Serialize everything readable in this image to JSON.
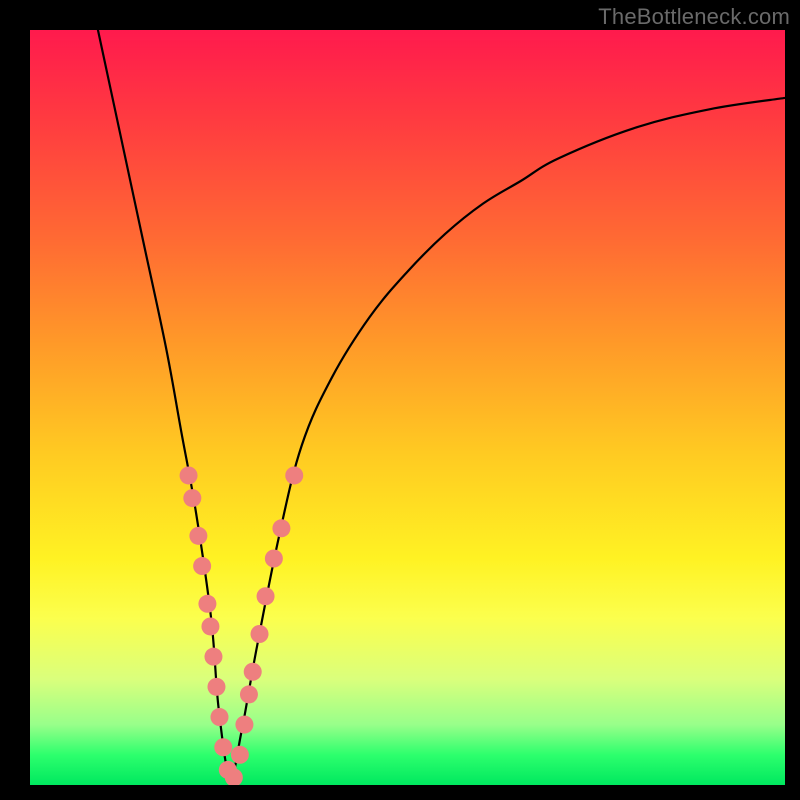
{
  "watermark": "TheBottleneck.com",
  "colors": {
    "frame": "#000000",
    "watermark_text": "#6a6a6a",
    "curve": "#000000",
    "dots": "#ee7f7f",
    "gradient_stops": [
      "#ff1a4d",
      "#ff3b40",
      "#ff6b33",
      "#ff9b28",
      "#ffca22",
      "#fff223",
      "#fbff4e",
      "#daff7c",
      "#98ff8a",
      "#2dff6d",
      "#00e85f"
    ]
  },
  "chart_data": {
    "type": "line",
    "title": "",
    "xlabel": "",
    "ylabel": "",
    "xlim": [
      0,
      100
    ],
    "ylim": [
      0,
      100
    ],
    "notes": "V-shaped bottleneck curve on vertical rainbow gradient; minimum is the optimal balance point; dots mark sampled hardware combos near the minimum.",
    "series": [
      {
        "name": "bottleneck-curve",
        "x": [
          9,
          12,
          15,
          18,
          20,
          22,
          24,
          25,
          26.5,
          28,
          30,
          33,
          36,
          40,
          45,
          50,
          55,
          60,
          65,
          70,
          80,
          90,
          100
        ],
        "y": [
          100,
          86,
          72,
          58,
          47,
          36,
          22,
          10,
          1,
          7,
          18,
          33,
          45,
          54,
          62,
          68,
          73,
          77,
          80,
          83,
          87,
          89.5,
          91
        ]
      }
    ],
    "points": [
      {
        "name": "sample",
        "x": 21.0,
        "y": 41
      },
      {
        "name": "sample",
        "x": 21.5,
        "y": 38
      },
      {
        "name": "sample",
        "x": 22.3,
        "y": 33
      },
      {
        "name": "sample",
        "x": 22.8,
        "y": 29
      },
      {
        "name": "sample",
        "x": 23.5,
        "y": 24
      },
      {
        "name": "sample",
        "x": 23.9,
        "y": 21
      },
      {
        "name": "sample",
        "x": 24.3,
        "y": 17
      },
      {
        "name": "sample",
        "x": 24.7,
        "y": 13
      },
      {
        "name": "sample",
        "x": 25.1,
        "y": 9
      },
      {
        "name": "sample",
        "x": 25.6,
        "y": 5
      },
      {
        "name": "sample",
        "x": 26.2,
        "y": 2
      },
      {
        "name": "sample",
        "x": 27.0,
        "y": 1
      },
      {
        "name": "sample",
        "x": 27.8,
        "y": 4
      },
      {
        "name": "sample",
        "x": 28.4,
        "y": 8
      },
      {
        "name": "sample",
        "x": 29.0,
        "y": 12
      },
      {
        "name": "sample",
        "x": 29.5,
        "y": 15
      },
      {
        "name": "sample",
        "x": 30.4,
        "y": 20
      },
      {
        "name": "sample",
        "x": 31.2,
        "y": 25
      },
      {
        "name": "sample",
        "x": 32.3,
        "y": 30
      },
      {
        "name": "sample",
        "x": 33.3,
        "y": 34
      },
      {
        "name": "sample",
        "x": 35.0,
        "y": 41
      }
    ]
  }
}
